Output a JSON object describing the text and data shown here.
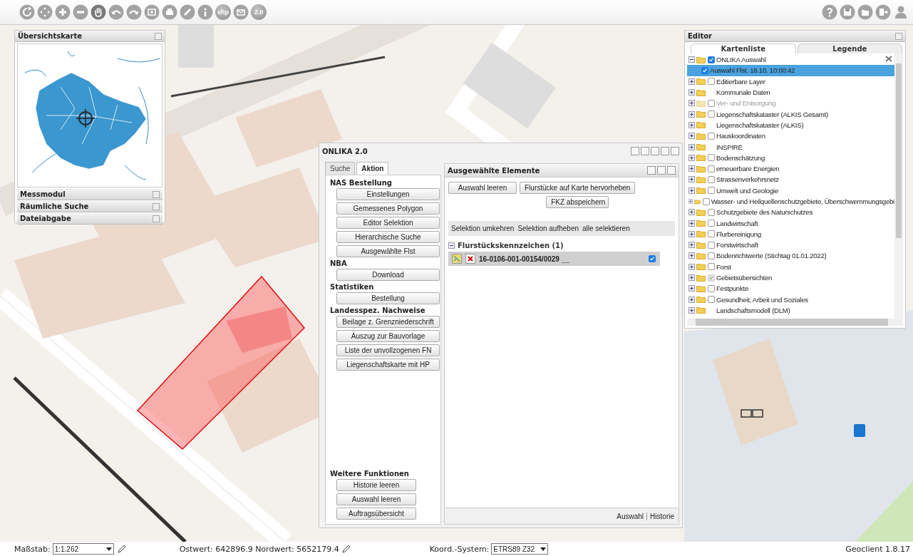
{
  "toolbar": {
    "shp_label": "shp",
    "version_label": "2.0"
  },
  "overview_panel": {
    "title": "Übersichtskarte",
    "sections": [
      "Messmodul",
      "Räumliche Suche",
      "Dateiabgabe"
    ]
  },
  "dialog": {
    "title": "ONLIKA 2.0",
    "tabs": [
      {
        "label": "Suche",
        "selected": false
      },
      {
        "label": "Aktion",
        "selected": true
      }
    ],
    "groups": [
      {
        "heading": "NAS Bestellung",
        "buttons": [
          "Einstellungen",
          "Gemessenes Polygon",
          "Editor Selektion",
          "Hierarchische Suche",
          "Ausgewählte Flst"
        ]
      },
      {
        "heading": "NBA",
        "buttons": [
          "Download"
        ]
      },
      {
        "heading": "Statistiken",
        "buttons": [
          "Bestellung"
        ]
      },
      {
        "heading": "Landesspez. Nachweise",
        "buttons": [
          "Beilage z. Grenzniederschrift",
          "Auszug zur Bauvorlage",
          "Liste der unvollzogenen FN",
          "Liegenschaftskarte mit HP"
        ]
      }
    ],
    "further": {
      "heading": "Weitere Funktionen",
      "buttons": [
        "Historie leeren",
        "Auswahl leeren",
        "Auftragsübersicht"
      ]
    },
    "selection": {
      "title": "Ausgewählte Elemente",
      "buttons": [
        "Auswahl leeren",
        "Flurstücke auf Karte hervorheben",
        "FKZ abspeichern"
      ],
      "links": [
        "Selektion umkehren",
        "Selektion aufheben",
        "alle selektieren"
      ],
      "group": {
        "title": "Flurstückskennzeichen (1)",
        "expanded": true,
        "items": [
          {
            "label": "16-0106-001-00154/0029 __",
            "checked": true
          }
        ]
      },
      "footer_links": [
        "Auswahl",
        "Historie"
      ]
    }
  },
  "editor": {
    "title": "Editor",
    "tabs": [
      {
        "label": "Kartenliste",
        "selected": true
      },
      {
        "label": "Legende",
        "selected": false
      }
    ],
    "tree": [
      {
        "label": "ONLIKA Auswahl",
        "expanded": true,
        "checked": true,
        "children": [
          {
            "label": "Auswahl Flst. 18.10. 10:00:42",
            "checked": true,
            "selected": true
          }
        ]
      },
      {
        "label": "Editierbare Layer",
        "expanded": false,
        "checked": false
      },
      {
        "label": "Kommunale Daten",
        "expanded": false
      },
      {
        "label": "Ver- und Entsorgung",
        "expanded": false,
        "checked": false,
        "disabled": true
      },
      {
        "label": "Liegenschaftskataster (ALKIS Gesamt)",
        "expanded": false,
        "checked": false
      },
      {
        "label": "Liegenschaftskataster (ALKIS)",
        "expanded": false
      },
      {
        "label": "Hauskoordinaten",
        "expanded": false,
        "checked": false
      },
      {
        "label": "INSPIRE",
        "expanded": false
      },
      {
        "label": "Bodenschätzung",
        "expanded": false,
        "checked": false
      },
      {
        "label": "erneuerbare Energien",
        "expanded": false,
        "checked": false
      },
      {
        "label": "Strassenverkehrsnetz",
        "expanded": false,
        "checked": false
      },
      {
        "label": "Umwelt und Geologie",
        "expanded": false,
        "checked": false
      },
      {
        "label": "Wasser- und Heilquellenschutzgebiete, Überschwemmungsgebi",
        "expanded": false,
        "checked": false
      },
      {
        "label": "Schutzgebiete des Naturschutzes",
        "expanded": false,
        "checked": false
      },
      {
        "label": "Landwirtschaft",
        "expanded": false,
        "checked": false
      },
      {
        "label": "Flurbereinigung",
        "expanded": false,
        "checked": false
      },
      {
        "label": "Forstwirtschaft",
        "expanded": false,
        "checked": false
      },
      {
        "label": "Bodenrichtwerte (Stichtag 01.01.2022)",
        "expanded": false,
        "checked": false
      },
      {
        "label": "Forst",
        "expanded": false,
        "checked": false
      },
      {
        "label": "Gebietsübersichten",
        "expanded": false,
        "checked": true,
        "check_disabled": true
      },
      {
        "label": "Festpunkte",
        "expanded": false,
        "checked": false
      },
      {
        "label": "Gesundheit, Arbeit und Soziales",
        "expanded": false,
        "checked": false
      },
      {
        "label": "Landschaftsmodell (DLM)",
        "expanded": false
      }
    ]
  },
  "status_bar": {
    "scale_label": "Maßstab:",
    "scale": "1:1.262",
    "coordinates": "Ostwert: 642896.9 Nordwert: 5652179.4",
    "crs_label": "Koord.-System:",
    "crs": "ETRS89 Z32",
    "version": "Geoclient 1.8.17"
  }
}
